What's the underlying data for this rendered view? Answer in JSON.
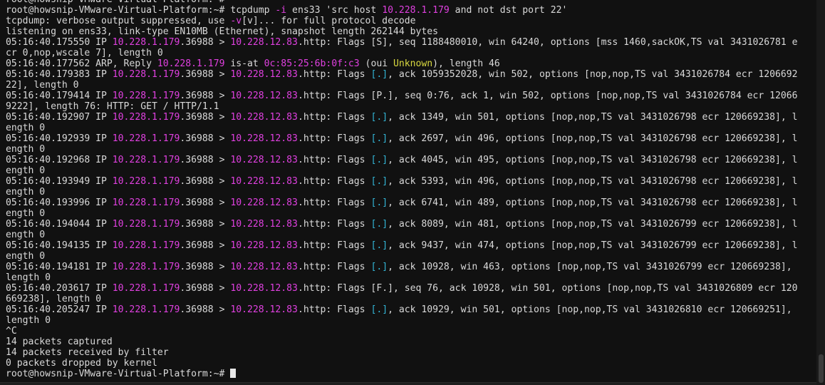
{
  "terminal": {
    "lines": [
      [
        {
          "t": "root@howsnip-VMware-Virtual-Platform:~# "
        }
      ],
      [
        {
          "t": "root@howsnip-VMware-Virtual-Platform:~# tcpdump "
        },
        {
          "t": "-i",
          "c": "magenta"
        },
        {
          "t": " ens33 'src host "
        },
        {
          "t": "10.228.1.179",
          "c": "magenta"
        },
        {
          "t": " and not dst port 22'"
        }
      ],
      [
        {
          "t": "tcpdump: verbose output suppressed, use "
        },
        {
          "t": "-v",
          "c": "magenta"
        },
        {
          "t": "[v]... for full protocol decode"
        }
      ],
      [
        {
          "t": "listening on ens33, link-type EN10MB (Ethernet), snapshot length 262144 bytes"
        }
      ],
      [
        {
          "t": "05:16:40.175550 IP "
        },
        {
          "t": "10.228.1.179",
          "c": "magenta"
        },
        {
          "t": ".36988 > "
        },
        {
          "t": "10.228.12.83",
          "c": "magenta"
        },
        {
          "t": ".http: Flags [S], seq 1188480010, win 64240, options [mss 1460,sackOK,TS val 3431026781 e"
        }
      ],
      [
        {
          "t": "cr 0,nop,wscale 7], length 0"
        }
      ],
      [
        {
          "t": "05:16:40.177562 ARP, Reply "
        },
        {
          "t": "10.228.1.179",
          "c": "magenta"
        },
        {
          "t": " is-at "
        },
        {
          "t": "0c:85:25:6b:0f:c3",
          "c": "magenta"
        },
        {
          "t": " (oui "
        },
        {
          "t": "Unknown",
          "c": "yellow"
        },
        {
          "t": "), length 46"
        }
      ],
      [
        {
          "t": "05:16:40.179383 IP "
        },
        {
          "t": "10.228.1.179",
          "c": "magenta"
        },
        {
          "t": ".36988 > "
        },
        {
          "t": "10.228.12.83",
          "c": "magenta"
        },
        {
          "t": ".http: Flags "
        },
        {
          "t": "[.]",
          "c": "cyan"
        },
        {
          "t": ", ack 1059352028, win 502, options [nop,nop,TS val 3431026784 ecr 1206692"
        }
      ],
      [
        {
          "t": "22], length 0"
        }
      ],
      [
        {
          "t": "05:16:40.179414 IP "
        },
        {
          "t": "10.228.1.179",
          "c": "magenta"
        },
        {
          "t": ".36988 > "
        },
        {
          "t": "10.228.12.83",
          "c": "magenta"
        },
        {
          "t": ".http: Flags [P.], seq 0:76, ack 1, win 502, options [nop,nop,TS val 3431026784 ecr 12066"
        }
      ],
      [
        {
          "t": "9222], length 76: HTTP: GET / HTTP/1.1"
        }
      ],
      [
        {
          "t": "05:16:40.192907 IP "
        },
        {
          "t": "10.228.1.179",
          "c": "magenta"
        },
        {
          "t": ".36988 > "
        },
        {
          "t": "10.228.12.83",
          "c": "magenta"
        },
        {
          "t": ".http: Flags "
        },
        {
          "t": "[.]",
          "c": "cyan"
        },
        {
          "t": ", ack 1349, win 501, options [nop,nop,TS val 3431026798 ecr 120669238], l"
        }
      ],
      [
        {
          "t": "ength 0"
        }
      ],
      [
        {
          "t": "05:16:40.192939 IP "
        },
        {
          "t": "10.228.1.179",
          "c": "magenta"
        },
        {
          "t": ".36988 > "
        },
        {
          "t": "10.228.12.83",
          "c": "magenta"
        },
        {
          "t": ".http: Flags "
        },
        {
          "t": "[.]",
          "c": "cyan"
        },
        {
          "t": ", ack 2697, win 496, options [nop,nop,TS val 3431026798 ecr 120669238], l"
        }
      ],
      [
        {
          "t": "ength 0"
        }
      ],
      [
        {
          "t": "05:16:40.192968 IP "
        },
        {
          "t": "10.228.1.179",
          "c": "magenta"
        },
        {
          "t": ".36988 > "
        },
        {
          "t": "10.228.12.83",
          "c": "magenta"
        },
        {
          "t": ".http: Flags "
        },
        {
          "t": "[.]",
          "c": "cyan"
        },
        {
          "t": ", ack 4045, win 495, options [nop,nop,TS val 3431026798 ecr 120669238], l"
        }
      ],
      [
        {
          "t": "ength 0"
        }
      ],
      [
        {
          "t": "05:16:40.193949 IP "
        },
        {
          "t": "10.228.1.179",
          "c": "magenta"
        },
        {
          "t": ".36988 > "
        },
        {
          "t": "10.228.12.83",
          "c": "magenta"
        },
        {
          "t": ".http: Flags "
        },
        {
          "t": "[.]",
          "c": "cyan"
        },
        {
          "t": ", ack 5393, win 496, options [nop,nop,TS val 3431026798 ecr 120669238], l"
        }
      ],
      [
        {
          "t": "ength 0"
        }
      ],
      [
        {
          "t": "05:16:40.193996 IP "
        },
        {
          "t": "10.228.1.179",
          "c": "magenta"
        },
        {
          "t": ".36988 > "
        },
        {
          "t": "10.228.12.83",
          "c": "magenta"
        },
        {
          "t": ".http: Flags "
        },
        {
          "t": "[.]",
          "c": "cyan"
        },
        {
          "t": ", ack 6741, win 489, options [nop,nop,TS val 3431026798 ecr 120669238], l"
        }
      ],
      [
        {
          "t": "ength 0"
        }
      ],
      [
        {
          "t": "05:16:40.194044 IP "
        },
        {
          "t": "10.228.1.179",
          "c": "magenta"
        },
        {
          "t": ".36988 > "
        },
        {
          "t": "10.228.12.83",
          "c": "magenta"
        },
        {
          "t": ".http: Flags "
        },
        {
          "t": "[.]",
          "c": "cyan"
        },
        {
          "t": ", ack 8089, win 481, options [nop,nop,TS val 3431026799 ecr 120669238], l"
        }
      ],
      [
        {
          "t": "ength 0"
        }
      ],
      [
        {
          "t": "05:16:40.194135 IP "
        },
        {
          "t": "10.228.1.179",
          "c": "magenta"
        },
        {
          "t": ".36988 > "
        },
        {
          "t": "10.228.12.83",
          "c": "magenta"
        },
        {
          "t": ".http: Flags "
        },
        {
          "t": "[.]",
          "c": "cyan"
        },
        {
          "t": ", ack 9437, win 474, options [nop,nop,TS val 3431026799 ecr 120669238], l"
        }
      ],
      [
        {
          "t": "ength 0"
        }
      ],
      [
        {
          "t": "05:16:40.194181 IP "
        },
        {
          "t": "10.228.1.179",
          "c": "magenta"
        },
        {
          "t": ".36988 > "
        },
        {
          "t": "10.228.12.83",
          "c": "magenta"
        },
        {
          "t": ".http: Flags "
        },
        {
          "t": "[.]",
          "c": "cyan"
        },
        {
          "t": ", ack 10928, win 463, options [nop,nop,TS val 3431026799 ecr 120669238],"
        }
      ],
      [
        {
          "t": "length 0"
        }
      ],
      [
        {
          "t": "05:16:40.203617 IP "
        },
        {
          "t": "10.228.1.179",
          "c": "magenta"
        },
        {
          "t": ".36988 > "
        },
        {
          "t": "10.228.12.83",
          "c": "magenta"
        },
        {
          "t": ".http: Flags [F.], seq 76, ack 10928, win 501, options [nop,nop,TS val 3431026809 ecr 120"
        }
      ],
      [
        {
          "t": "669238], length 0"
        }
      ],
      [
        {
          "t": "05:16:40.205247 IP "
        },
        {
          "t": "10.228.1.179",
          "c": "magenta"
        },
        {
          "t": ".36988 > "
        },
        {
          "t": "10.228.12.83",
          "c": "magenta"
        },
        {
          "t": ".http: Flags "
        },
        {
          "t": "[.]",
          "c": "cyan"
        },
        {
          "t": ", ack 10929, win 501, options [nop,nop,TS val 3431026810 ecr 120669251],"
        }
      ],
      [
        {
          "t": "length 0"
        }
      ],
      [
        {
          "t": "^C"
        }
      ],
      [
        {
          "t": "14 packets captured"
        }
      ],
      [
        {
          "t": "14 packets received by filter"
        }
      ],
      [
        {
          "t": "0 packets dropped by kernel"
        }
      ],
      [
        {
          "t": "root@howsnip-VMware-Virtual-Platform:~# "
        }
      ]
    ]
  },
  "colors": {
    "background": "#111111",
    "foreground": "#d9d9d9",
    "magenta": "#e040e0",
    "cyan": "#33b5d6",
    "yellow": "#d8d840"
  }
}
